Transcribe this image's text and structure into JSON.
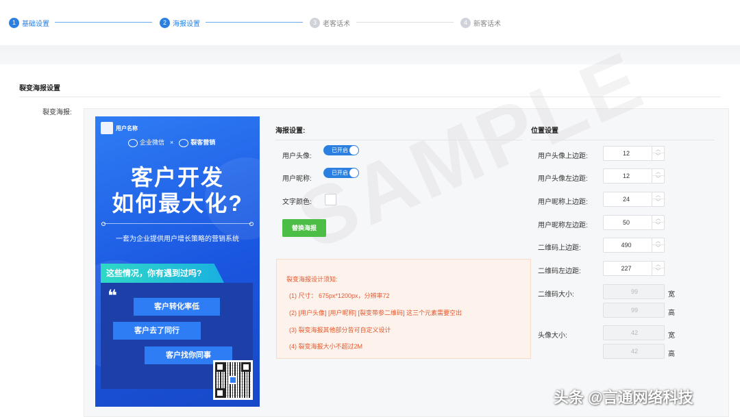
{
  "steps": [
    {
      "num": "1",
      "label": "基础设置"
    },
    {
      "num": "2",
      "label": "海报设置"
    },
    {
      "num": "3",
      "label": "老客话术"
    },
    {
      "num": "4",
      "label": "新客话术"
    }
  ],
  "section": {
    "title": "裂变海报设置",
    "field_label": "裂变海报:"
  },
  "poster": {
    "user_name": "用户名称",
    "brand_left": "企业微信",
    "brand_x": "×",
    "brand_right": "裂客营销",
    "headline_1": "客户开发",
    "headline_2": "如何最大化?",
    "subtitle": "一套为企业提供用户增长策略的营销系统",
    "banner": "这些情况，你有遇到过吗?",
    "quote": "❝",
    "pills": [
      "客户转化率低",
      "客户去了同行",
      "客户找你同事"
    ]
  },
  "poster_settings": {
    "title": "海报设置:",
    "avatar_label": "用户头像:",
    "avatar_toggle": "已开启",
    "nickname_label": "用户昵称:",
    "nickname_toggle": "已开启",
    "text_color_label": "文字颜色:",
    "replace_button": "替换海报"
  },
  "notice": {
    "title": "裂变海报设计须知:",
    "items": [
      "(1) 尺寸： 675px*1200px，分辨率72",
      "(2) [用户头像] [用户昵称] [裂变带参二维码] 这三个元素需要空出",
      "(3) 裂变海报其他部分皆可自定义设计",
      "(4) 裂变海报大小不超过2M"
    ]
  },
  "position": {
    "title": "位置设置",
    "fields": [
      {
        "label": "用户头像上边距:",
        "value": "12"
      },
      {
        "label": "用户头像左边距:",
        "value": "12"
      },
      {
        "label": "用户昵称上边距:",
        "value": "24"
      },
      {
        "label": "用户昵称左边距:",
        "value": "50"
      },
      {
        "label": "二维码上边距:",
        "value": "490"
      },
      {
        "label": "二维码左边距:",
        "value": "227"
      }
    ],
    "qr_size_label": "二维码大小:",
    "qr_width": "99",
    "qr_height": "99",
    "avatar_size_label": "头像大小:",
    "avatar_width": "42",
    "avatar_height": "42",
    "unit_width": "宽",
    "unit_height": "高"
  },
  "watermark_text": "SAMPLE",
  "footer_watermark": "头条 @言通网络科技",
  "colors": {
    "accent": "#2a7fe0",
    "green": "#4cbd45",
    "notice": "#e4572e"
  }
}
